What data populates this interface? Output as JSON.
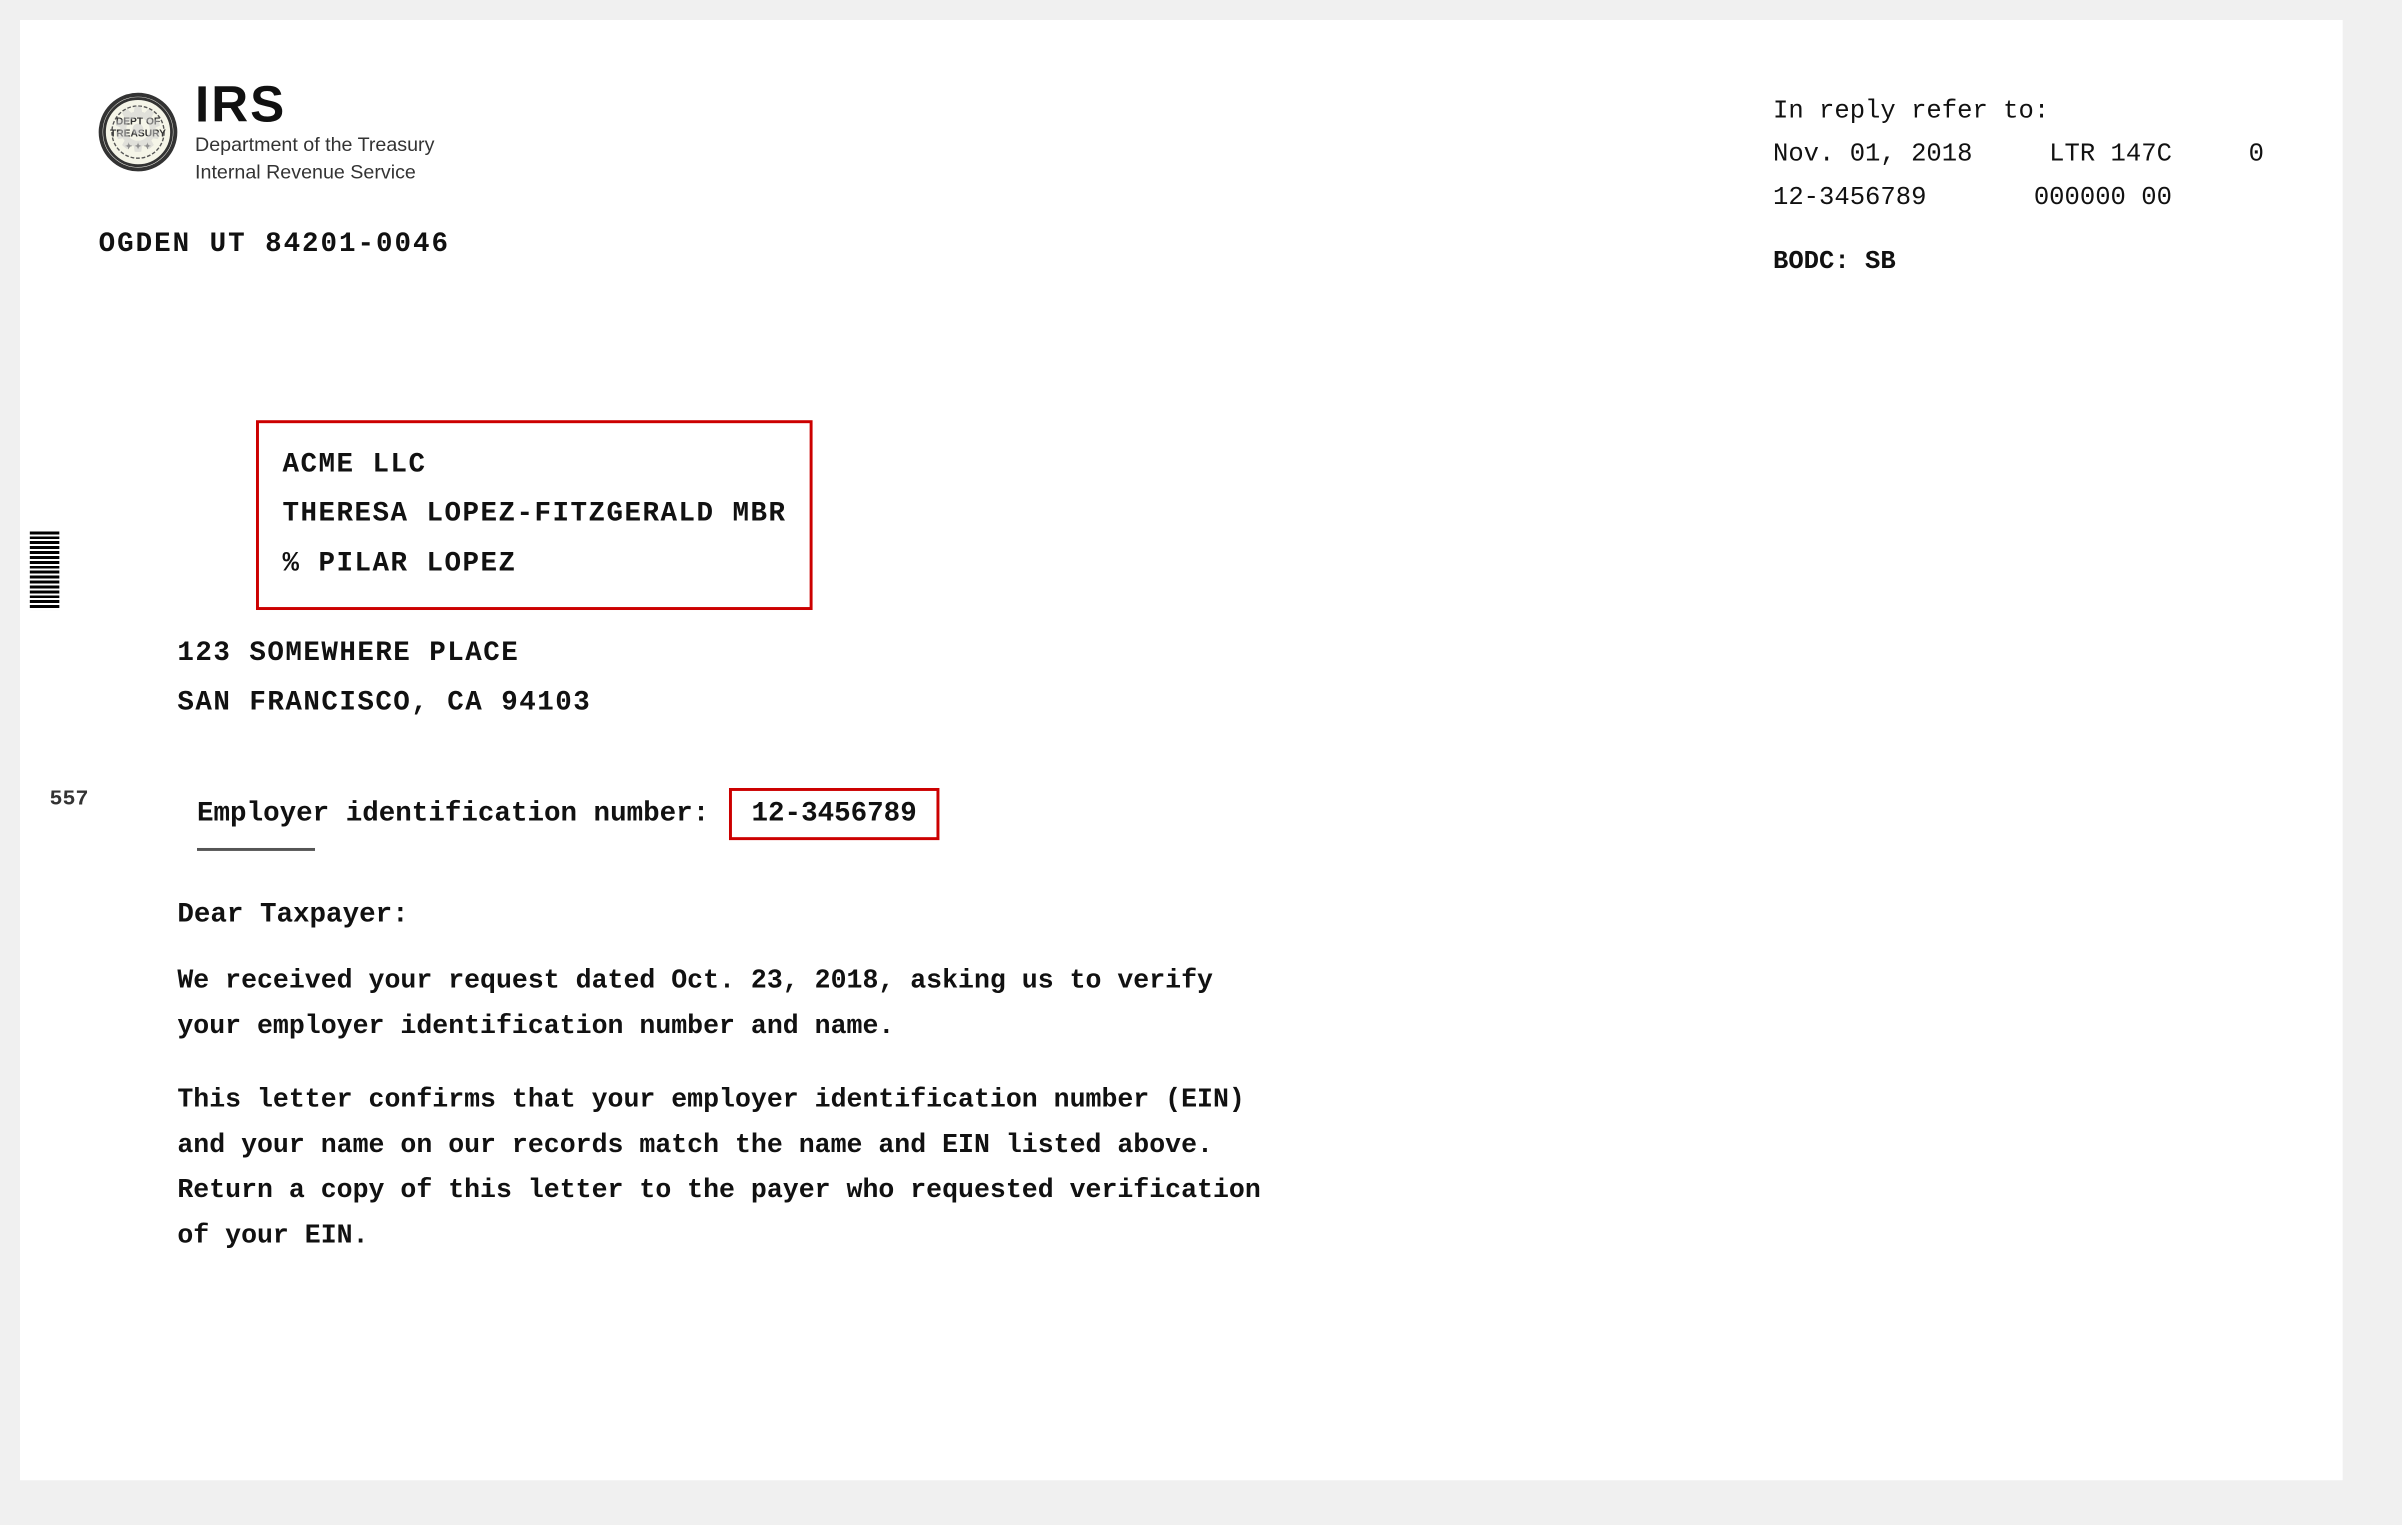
{
  "document": {
    "background_color": "#ffffff"
  },
  "header": {
    "irs_logo_text": "IRS",
    "irs_dept_line1": "Department of the Treasury",
    "irs_dept_line2": "Internal Revenue Service",
    "sender_address": "OGDEN  UT  84201-0046",
    "reply_label": "In reply refer to:",
    "reply_date": "Nov. 01, 2018",
    "reply_ltr": "LTR 147C",
    "reply_ltr_num": "0",
    "reply_ein": "12-3456789",
    "reply_zeros": "000000 00",
    "bodc_label": "BODC: SB"
  },
  "recipient": {
    "line1": "ACME LLC",
    "line2": "THERESA LOPEZ-FITZGERALD MBR",
    "line3": "% PILAR LOPEZ",
    "address1": "123 SOMEWHERE PLACE",
    "address2": "SAN FRANCISCO, CA    94103"
  },
  "ein_section": {
    "label": "Employer identification number:",
    "value": "12-3456789"
  },
  "page_number": "557",
  "letter": {
    "salutation": "Dear Taxpayer:",
    "paragraph1": "We received your request dated Oct. 23, 2018, asking us to verify\nyour employer identification number and name.",
    "paragraph2": "This letter confirms that your employer identification number (EIN)\nand your name on our records match the name and EIN listed above.\nReturn a copy of this letter to the payer who requested verification\nof your EIN."
  }
}
